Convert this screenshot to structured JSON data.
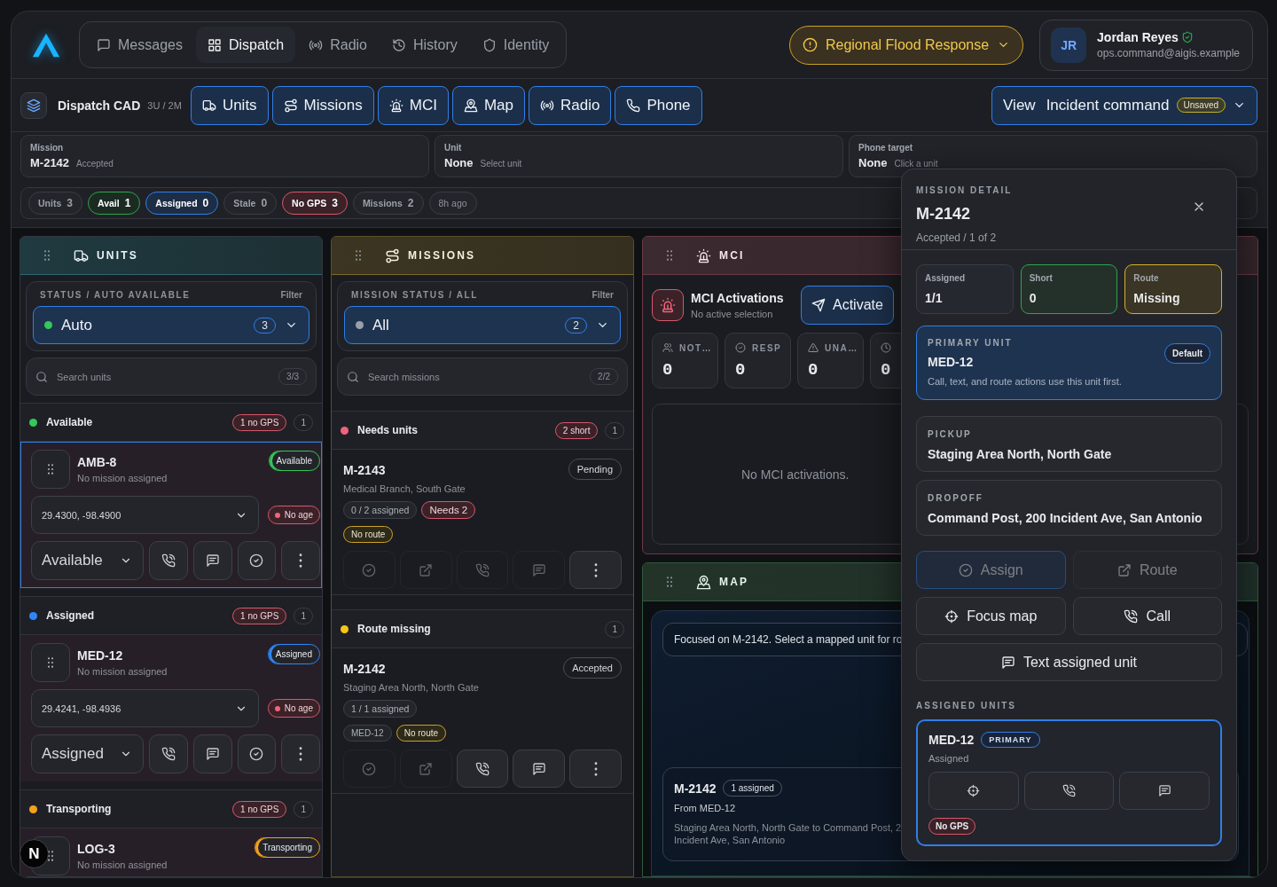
{
  "nav": {
    "items": [
      {
        "label": "Messages",
        "selected": false
      },
      {
        "label": "Dispatch",
        "selected": true
      },
      {
        "label": "Radio",
        "selected": false
      },
      {
        "label": "History",
        "selected": false
      },
      {
        "label": "Identity",
        "selected": false
      }
    ]
  },
  "incident": {
    "label": "Regional Flood Response"
  },
  "user": {
    "initials": "JR",
    "name": "Jordan Reyes",
    "email": "ops.command@aigis.example",
    "verified": true
  },
  "toolbar": {
    "title": "Dispatch CAD",
    "counts": "3U / 2M",
    "tabs": [
      {
        "label": "Units",
        "on": true
      },
      {
        "label": "Missions",
        "on": true
      },
      {
        "label": "MCI",
        "on": true
      },
      {
        "label": "Map",
        "on": true
      },
      {
        "label": "Radio",
        "on": true
      },
      {
        "label": "Phone",
        "on": true
      }
    ],
    "view": {
      "prefix": "View",
      "label": "Incident command",
      "badge": "Unsaved"
    }
  },
  "context": [
    {
      "label": "Mission",
      "value": "M-2142",
      "hint": "Accepted"
    },
    {
      "label": "Unit",
      "value": "None",
      "hint": "Select unit"
    },
    {
      "label": "Phone target",
      "value": "None",
      "hint": "Click a unit"
    }
  ],
  "chips": [
    {
      "label": "Units",
      "count": "3",
      "kind": "neutral"
    },
    {
      "label": "Avail",
      "count": "1",
      "kind": "green"
    },
    {
      "label": "Assigned",
      "count": "0",
      "kind": "blue"
    },
    {
      "label": "Stale",
      "count": "0",
      "kind": "neutral"
    },
    {
      "label": "No GPS",
      "count": "3",
      "kind": "red"
    },
    {
      "label": "Missions",
      "count": "2",
      "kind": "neutral"
    },
    {
      "label": "8h ago",
      "kind": "muted"
    }
  ],
  "units_panel": {
    "title": "UNITS",
    "filter_label": "STATUS / AUTO AVAILABLE",
    "filter_action": "Filter",
    "filter_value": "Auto",
    "filter_count": "3",
    "search_placeholder": "Search units",
    "search_count": "3/3",
    "groups": [
      {
        "label": "Available",
        "color": "#34c759",
        "gps": "1 no GPS",
        "count": "1",
        "units": [
          {
            "name": "AMB-8",
            "mission": "No mission assigned",
            "status": "Available",
            "coords": "29.4300, -98.4900",
            "age": "No age",
            "select": "Available",
            "selected": true
          }
        ]
      },
      {
        "label": "Assigned",
        "color": "#2f86f6",
        "gps": "1 no GPS",
        "count": "1",
        "units": [
          {
            "name": "MED-12",
            "mission": "No mission assigned",
            "status": "Assigned",
            "coords": "29.4241, -98.4936",
            "age": "No age",
            "select": "Assigned",
            "selected": false
          }
        ]
      },
      {
        "label": "Transporting",
        "color": "#f5a11c",
        "gps": "1 no GPS",
        "count": "1",
        "units": [
          {
            "name": "LOG-3",
            "mission": "No mission assigned",
            "status": "Transporting",
            "selected": false
          }
        ]
      }
    ]
  },
  "missions_panel": {
    "title": "MISSIONS",
    "filter_label": "MISSION STATUS / ALL",
    "filter_action": "Filter",
    "filter_value": "All",
    "filter_count": "2",
    "search_placeholder": "Search missions",
    "search_count": "2/2",
    "groups": [
      {
        "label": "Needs units",
        "color": "#f0637a",
        "short": "2 short",
        "count": "1",
        "missions": [
          {
            "id": "M-2143",
            "place": "Medical Branch, South Gate",
            "status": "Pending",
            "assigned": "0 / 2 assigned",
            "needs": "Needs 2",
            "route": "No route",
            "actions": [
              {
                "disabled": true
              },
              {
                "disabled": true
              },
              {
                "disabled": true
              },
              {
                "disabled": true
              },
              {
                "disabled": false
              }
            ]
          }
        ]
      },
      {
        "label": "Route missing",
        "color": "#f5c518",
        "count": "1",
        "missions": [
          {
            "id": "M-2142",
            "place": "Staging Area North, North Gate",
            "status": "Accepted",
            "assigned": "1 / 1 assigned",
            "units": [
              "MED-12"
            ],
            "route": "No route",
            "actions": [
              {
                "disabled": true
              },
              {
                "disabled": true
              },
              {
                "disabled": false
              },
              {
                "disabled": false
              },
              {
                "disabled": false
              }
            ]
          }
        ]
      }
    ]
  },
  "mci_panel": {
    "title": "MCI",
    "heading": "MCI Activations",
    "sub": "No active selection",
    "action": "Activate",
    "stats": [
      {
        "label": "NOT…",
        "value": "0"
      },
      {
        "label": "RESP",
        "value": "0"
      },
      {
        "label": "UNA…",
        "value": "0"
      },
      {
        "value": "0"
      }
    ],
    "empty": "No MCI activations."
  },
  "map_panel": {
    "title": "MAP",
    "focus": "Focused on M-2142. Select a mapped unit for ro",
    "card": {
      "id": "M-2142",
      "badge": "1 assigned",
      "from": "From MED-12",
      "route_lines": [
        "Staging Area North, North Gate to Command Post, 2",
        "Incident Ave, San Antonio"
      ]
    }
  },
  "mission_detail": {
    "label": "MISSION DETAIL",
    "id": "M-2142",
    "sub": "Accepted / 1 of 2",
    "stats": [
      {
        "label": "Assigned",
        "value": "1/1",
        "kind": "neutral"
      },
      {
        "label": "Short",
        "value": "0",
        "kind": "good"
      },
      {
        "label": "Route",
        "value": "Missing",
        "kind": "warn"
      }
    ],
    "primary": {
      "label": "PRIMARY UNIT",
      "name": "MED-12",
      "badge": "Default",
      "note": "Call, text, and route actions use this unit first."
    },
    "pickup": {
      "label": "PICKUP",
      "value": "Staging Area North, North Gate"
    },
    "dropoff": {
      "label": "DROPOFF",
      "value": "Command Post, 200 Incident Ave, San Antonio"
    },
    "actions": [
      {
        "label": "Assign",
        "kind": "primary",
        "disabled": true
      },
      {
        "label": "Route",
        "kind": "plain",
        "disabled": true
      },
      {
        "label": "Focus map",
        "kind": "plain",
        "disabled": false
      },
      {
        "label": "Call",
        "kind": "plain",
        "disabled": false
      },
      {
        "label": "Text assigned unit",
        "kind": "plain",
        "disabled": false
      }
    ],
    "assigned_heading": "ASSIGNED UNITS",
    "assigned": [
      {
        "name": "MED-12",
        "badge": "PRIMARY",
        "status": "Assigned",
        "gps": "No GPS",
        "selected": true
      }
    ]
  },
  "dev_badge": "N"
}
